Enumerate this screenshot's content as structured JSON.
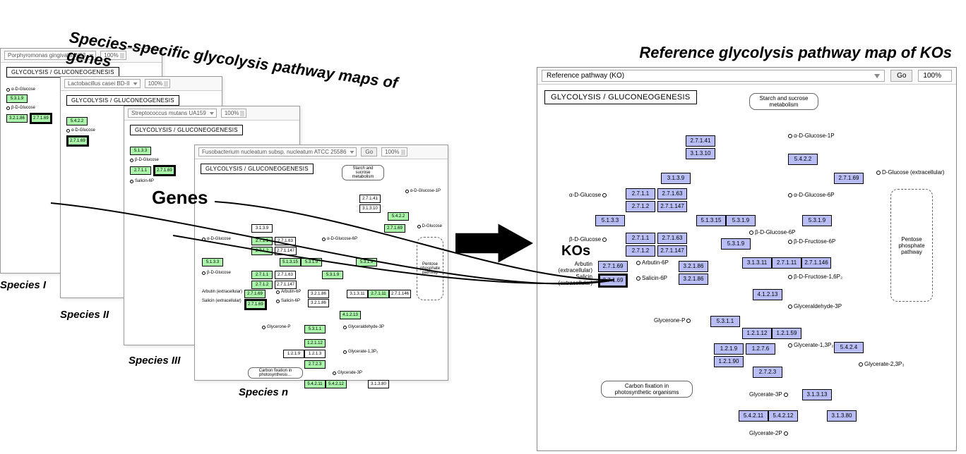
{
  "titles": {
    "left": "Species-specific glycolysis pathway maps of genes",
    "right": "Reference glycolysis pathway map of KOs",
    "genes_label": "Genes",
    "kos_label": "KOs"
  },
  "species_labels": [
    "Species I",
    "Species II",
    "Species III",
    "Species n"
  ],
  "cards": {
    "headers": [
      "Porphyromonas gingivalis W83",
      "Lactobacillus casei BD-II",
      "Streptococcus mutans UA159",
      "Fusobacterium nucleatum subsp. nucleatum ATCC 25586"
    ],
    "go_button": "Go",
    "zoom": "100%",
    "pathway_title": "GLYCOLYSIS / GLUCONEOGENESIS"
  },
  "reference": {
    "dropdown": "Reference pathway (KO)",
    "go_button": "Go",
    "zoom": "100%",
    "pathway_title": "GLYCOLYSIS / GLUCONEOGENESIS"
  },
  "compounds": {
    "starch_sucrose": "Starch and sucrose metabolism",
    "a_d_glucose_1p": "α-D-Glucose-1P",
    "d_glucose_ext": "D-Glucose (extracellular)",
    "a_d_glucose": "α-D-Glucose",
    "a_d_glucose_6p": "α-D-Glucose-6P",
    "b_d_glucose": "β-D-Glucose",
    "b_d_glucose_6p": "β-D-Glucose-6P",
    "b_d_fructose_6p": "β-D-Fructose-6P",
    "b_d_fructose_16p2": "β-D-Fructose-1,6P₂",
    "glyceraldehyde_3p": "Glyceraldehyde-3P",
    "glycerone_p": "Glycerone-P",
    "glycerate_13p2": "Glycerate-1,3P₂",
    "glycerate_23p3": "Glycerate-2,3P₃",
    "glycerate_3p": "Glycerate-3P",
    "glycerate_2p": "Glycerate-2P",
    "arbutin_ext": "Arbutin (extracellular)",
    "salicin_ext": "Salicin (extracellular)",
    "arbutin_6p": "Arbutin-6P",
    "salicin_6p": "Salicin-6P",
    "pentose_phosphate": "Pentose phosphate pathway",
    "carbon_fixation": "Carbon fixation in photosynthetic organisms"
  },
  "ec": {
    "2_7_1_41": "2.7.1.41",
    "3_1_3_10": "3.1.3.10",
    "5_4_2_2": "5.4.2.2",
    "3_1_3_9": "3.1.3.9",
    "2_7_1_69": "2.7.1.69",
    "2_7_1_1": "2.7.1.1",
    "2_7_1_63": "2.7.1.63",
    "2_7_1_2": "2.7.1.2",
    "2_7_1_147": "2.7.1.147",
    "5_1_3_3": "5.1.3.3",
    "5_1_3_15": "5.1.3.15",
    "5_3_1_9": "5.3.1.9",
    "3_2_1_86": "3.2.1.86",
    "3_1_3_11": "3.1.3.11",
    "2_7_1_11": "2.7.1.11",
    "2_7_1_146": "2.7.1.146",
    "4_1_2_13": "4.1.2.13",
    "5_3_1_1": "5.3.1.1",
    "1_2_1_12": "1.2.1.12",
    "1_2_1_59": "1.2.1.59",
    "1_2_1_9": "1.2.1.9",
    "1_2_7_6": "1.2.7.6",
    "1_2_1_90": "1.2.1.90",
    "5_4_2_4": "5.4.2.4",
    "2_7_2_3": "2.7.2.3",
    "3_1_3_13": "3.1.3.13",
    "5_4_2_11": "5.4.2.11",
    "5_4_2_12": "5.4.2.12",
    "3_1_3_80": "3.1.3.80"
  },
  "mini_ec": {
    "5_3_1_9": "5.3.1.9",
    "3_2_1_86": "3.2.1.86",
    "2_7_1_69": "2.7.1.69",
    "5_1_3_3": "5.1.3.3",
    "2_7_1_1": "2.7.1.1",
    "5_4_2_2": "5.4.2.2",
    "3_1_3_9": "3.1.3.9",
    "4_1_2_13": "4.1.2.13",
    "5_3_1_1": "5.3.1.1",
    "1_2_1_12": "1.2.1.12",
    "2_7_2_3": "2.7.2.3",
    "5_4_2_11": "5.4.2.11",
    "3_1_3_11": "3.1.3.11",
    "2_7_1_11": "2.7.1.11"
  }
}
